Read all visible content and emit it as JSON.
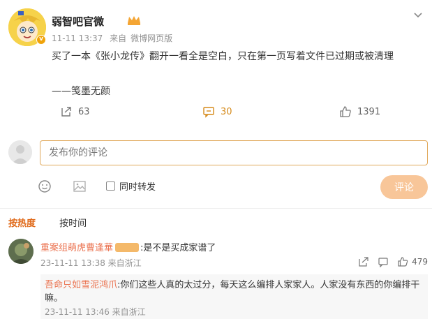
{
  "post": {
    "author": "弱智吧官微",
    "time": "11-11 13:37",
    "source_prefix": "来自",
    "source": "微博网页版",
    "content": "买了一本《张小龙传》翻开一看全是空白，只在第一页写着文件已过期或被清理",
    "signature": "——笺墨无颜"
  },
  "actions": {
    "repost_count": "63",
    "comment_count": "30",
    "like_count": "1391",
    "accent": "#d58a1a"
  },
  "compose": {
    "placeholder": "发布你的评论",
    "repost_label": "同时转发",
    "submit_label": "评论",
    "submit_color": "#f8c699"
  },
  "sort": {
    "hot_label": "按热度",
    "time_label": "按时间",
    "active_color": "#e06a1a"
  },
  "comments": [
    {
      "user": "重案组萌虎曹逢華",
      "text": ":是不是买成家谱了",
      "time": "23-11-11 13:38 来自浙江",
      "like_count": "479",
      "reply": {
        "user": "吾命只如雪泥鸿爪",
        "text": ":你们这些人真的太过分，每天这么编排人家家人。人家没有东西的你编排干嘛。",
        "time": "23-11-11 13:46 来自浙江"
      }
    }
  ],
  "icons": {
    "more": "chevron-down-icon",
    "repost": "repost-icon",
    "comment": "comment-icon",
    "like": "thumbs-up-icon",
    "emoji": "emoji-icon",
    "image": "image-icon",
    "share": "share-icon"
  }
}
